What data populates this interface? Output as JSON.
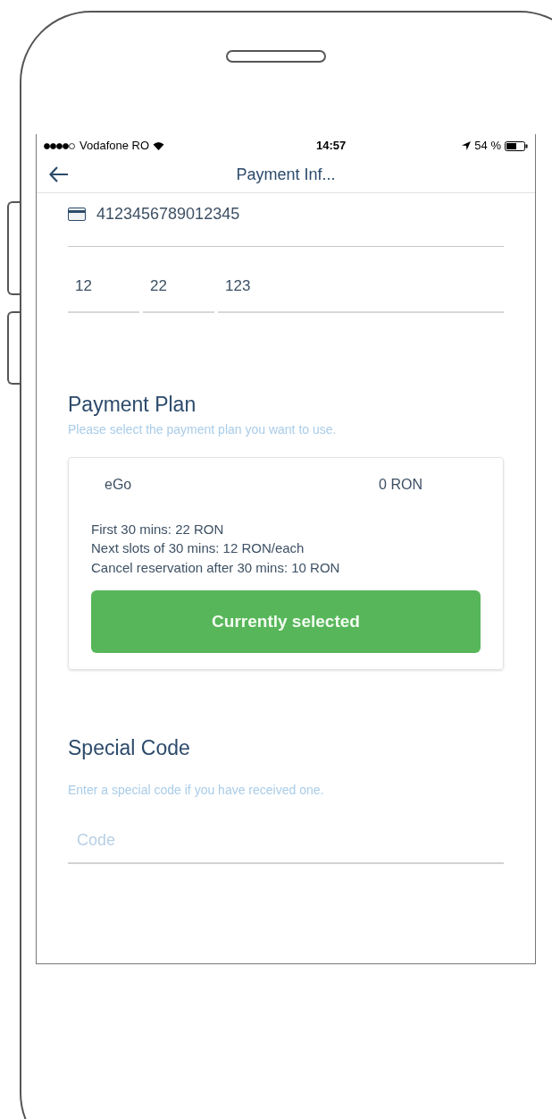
{
  "status_bar": {
    "carrier": "Vodafone RO",
    "time": "14:57",
    "battery": "54 %"
  },
  "nav": {
    "title": "Payment Inf..."
  },
  "card": {
    "number": "4123456789012345",
    "fields": [
      {
        "value": "12"
      },
      {
        "value": "22"
      },
      {
        "value": "123"
      }
    ]
  },
  "payment_plan": {
    "title": "Payment Plan",
    "subtitle": "Please select the payment plan you want to use.",
    "plans": [
      {
        "name": "eGo",
        "price": "0 RON",
        "details": [
          "First 30 mins: 22 RON",
          "Next slots of 30 mins: 12 RON/each",
          "Cancel reservation after 30 mins: 10 RON"
        ],
        "button": "Currently selected",
        "selected": true
      }
    ]
  },
  "special_code": {
    "title": "Special Code",
    "subtitle": "Enter a special code if you have received one.",
    "placeholder": "Code"
  }
}
